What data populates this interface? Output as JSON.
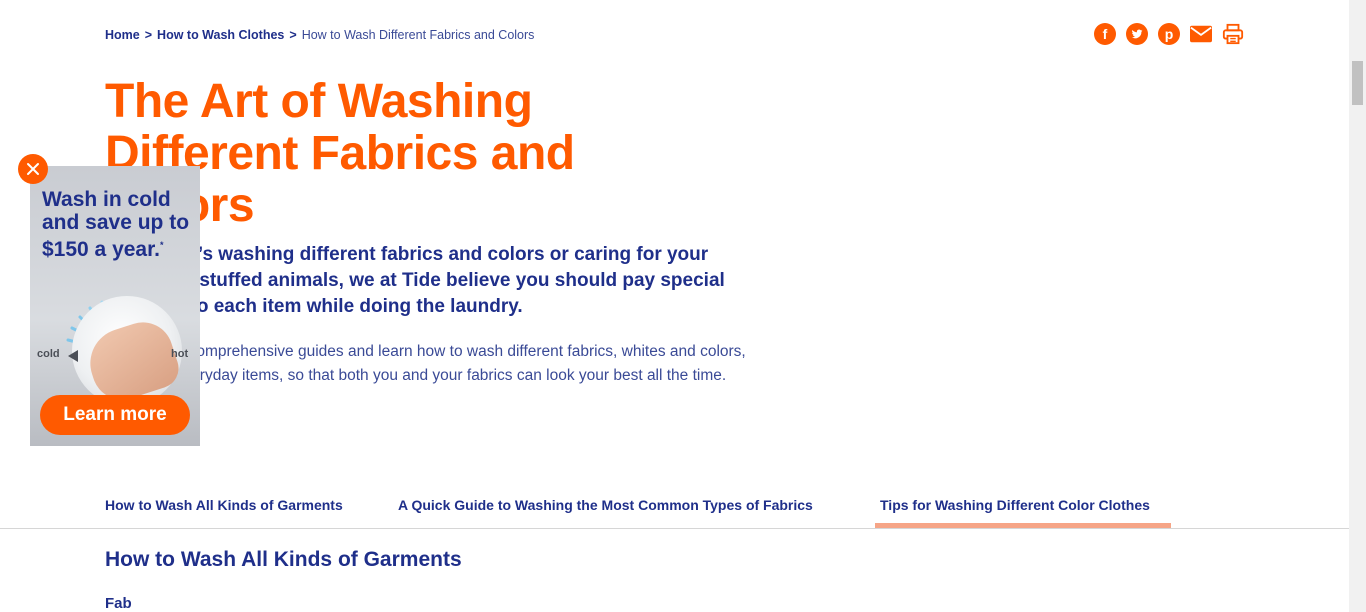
{
  "breadcrumb": {
    "items": [
      {
        "label": "Home"
      },
      {
        "label": "How to Wash Clothes"
      },
      {
        "label": "How to Wash Different Fabrics and Colors"
      }
    ],
    "separator": ">"
  },
  "share": {
    "icons": [
      "facebook-icon",
      "twitter-icon",
      "pinterest-icon",
      "email-icon",
      "print-icon"
    ]
  },
  "article": {
    "title": "The Art of Washing Different Fabrics and Colors",
    "intro": "Whether it’s washing different fabrics and colors or caring for your children’s stuffed animals, we at Tide believe you should pay special attention to each item while doing the laundry.",
    "body": "Explore our comprehensive guides and learn how to wash different fabrics, whites and colors, and other everyday items, so that both you and your fabrics can look your best all the time."
  },
  "tabs": [
    {
      "label": "How to Wash All Kinds of Garments",
      "active": false
    },
    {
      "label": "A Quick Guide to Washing the Most Common Types of Fabrics",
      "active": false
    },
    {
      "label": "Tips for Washing Different Color Clothes",
      "active": true
    }
  ],
  "section": {
    "title": "How to Wash All Kinds of Garments",
    "sublabel": "Fab"
  },
  "ad": {
    "headline": "Wash in cold and save up to $150 a year.",
    "asterisk": "*",
    "dial_cold": "cold",
    "dial_hot": "hot",
    "cta": "Learn more"
  },
  "colors": {
    "brand_orange": "#ff5a00",
    "navy": "#1f2f8a",
    "tab_underline": "#f6a587"
  }
}
